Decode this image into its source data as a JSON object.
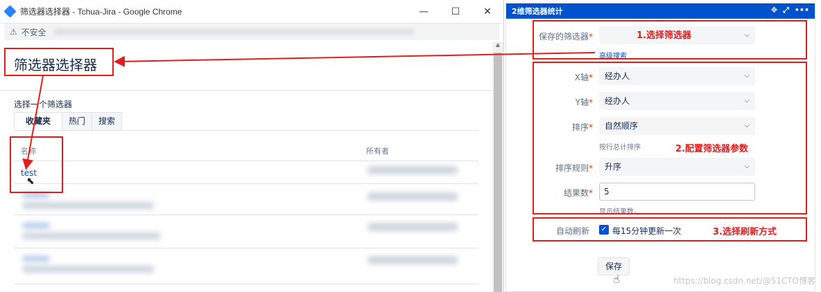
{
  "browser": {
    "title": "筛选器选择器 - Tchua-Jira - Google Chrome",
    "security_label": "不安全",
    "window_buttons": [
      "—",
      "☐",
      "✕"
    ]
  },
  "dialog": {
    "title": "筛选器选择器",
    "choose_label": "选择一个筛选器",
    "tabs": [
      "收藏夹",
      "热门",
      "搜索"
    ],
    "columns": {
      "name": "名称",
      "owner": "所有者"
    },
    "first_row_name": "test"
  },
  "panel": {
    "header": "2维筛选器统计",
    "saved_filter_label": "保存的筛选器",
    "advanced_search": "高级搜索",
    "x_axis_label": "X轴",
    "x_axis_value": "经办人",
    "y_axis_label": "Y轴",
    "y_axis_value": "经办人",
    "sort_label": "排序",
    "sort_value": "自然顺序",
    "sort_hint": "按行总计排序",
    "sort_rule_label": "排序规则",
    "sort_rule_value": "升序",
    "results_label": "结果数",
    "results_value": "5",
    "results_hint": "显示结果数。",
    "auto_refresh_label": "自动刷新",
    "auto_refresh_option": "每15分钟更新一次",
    "save_button": "保存"
  },
  "annotations": {
    "step1": "1.选择筛选器",
    "step2": "2.配置筛选器参数",
    "step3": "3.选择刷新方式",
    "accent_color": "#e01e1e"
  },
  "watermark": "https://blog.csdn.net/@51CTO博客"
}
